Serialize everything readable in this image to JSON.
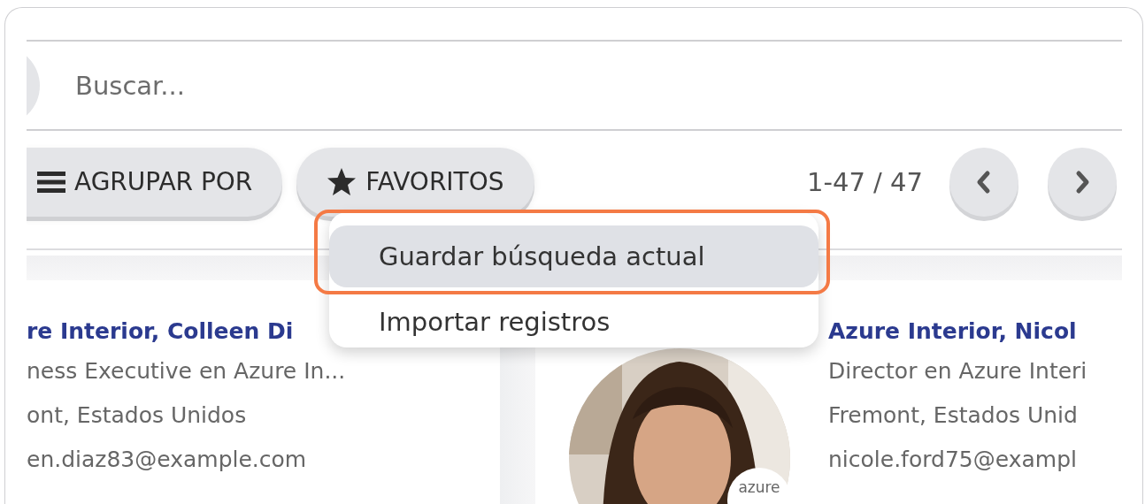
{
  "search": {
    "placeholder": "Buscar..."
  },
  "toolbar": {
    "buttons": [
      {
        "kind": "group_by",
        "label": "AGRUPAR POR"
      },
      {
        "kind": "favorites",
        "label": "FAVORITOS"
      }
    ],
    "pager": "1-47 / 47"
  },
  "favorites_menu": {
    "items": [
      {
        "label": "Guardar búsqueda actual",
        "selected": true,
        "highlighted": true
      },
      {
        "label": "Importar registros",
        "selected": false,
        "highlighted": false
      }
    ]
  },
  "cards": [
    {
      "title": "re Interior, Colleen Di",
      "lines": [
        "ness Executive en Azure In...",
        "ont, Estados Unidos",
        "en.diaz83@example.com"
      ]
    },
    {
      "title": "Azure Interior, Nicol",
      "lines": [
        "Director en Azure Interi",
        "Fremont, Estados Unid",
        "nicole.ford75@exampl"
      ],
      "photo": {
        "kind": "picture",
        "badge": "azure"
      }
    }
  ]
}
